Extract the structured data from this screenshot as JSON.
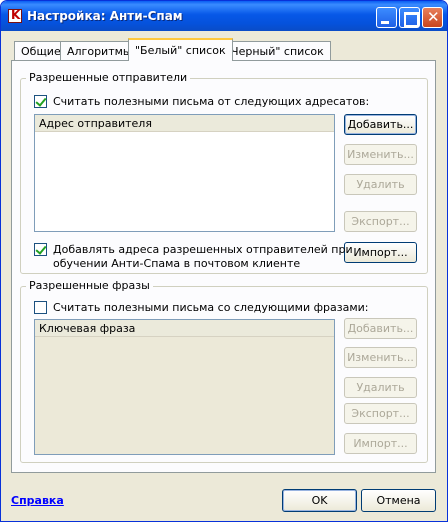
{
  "window": {
    "title": "Настройка: Анти-Спам",
    "app_icon_letter": "K"
  },
  "tabs": [
    {
      "label": "Общие",
      "active": false
    },
    {
      "label": "Алгоритмы",
      "active": false
    },
    {
      "label": "\"Белый\" список",
      "active": true
    },
    {
      "label": "\"Черный\" список",
      "active": false
    }
  ],
  "allowed_senders": {
    "group_title": "Разрешенные отправители",
    "use_checkbox_label": "Считать полезными письма от следующих адресатов:",
    "use_checked": true,
    "column_header": "Адрес отправителя",
    "add_label": "Добавить...",
    "edit_label": "Изменить...",
    "delete_label": "Удалить",
    "export_label": "Экспорт...",
    "import_label": "Импорт...",
    "learn_checkbox_line1": "Добавлять адреса разрешенных отправителей при",
    "learn_checkbox_line2": "обучении Анти-Спама в почтовом клиенте",
    "learn_checked": true
  },
  "allowed_phrases": {
    "group_title": "Разрешенные фразы",
    "use_checkbox_label": "Считать полезными письма со следующими фразами:",
    "use_checked": false,
    "column_header": "Ключевая фраза",
    "add_label": "Добавить...",
    "edit_label": "Изменить...",
    "delete_label": "Удалить",
    "export_label": "Экспорт...",
    "import_label": "Импорт..."
  },
  "footer": {
    "help_link": "Справка",
    "ok_label": "OK",
    "cancel_label": "Отмена"
  }
}
